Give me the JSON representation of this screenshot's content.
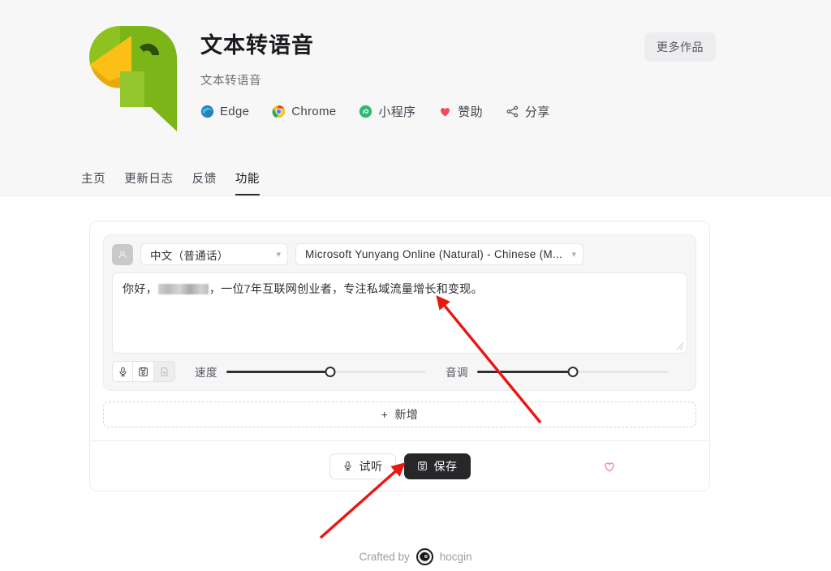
{
  "header": {
    "app_title": "文本转语音",
    "app_subtitle": "文本转语音",
    "more_works_label": "更多作品",
    "links": [
      {
        "label": "Edge",
        "icon": "edge-icon"
      },
      {
        "label": "Chrome",
        "icon": "chrome-icon"
      },
      {
        "label": "小程序",
        "icon": "miniprogram-icon"
      },
      {
        "label": "赞助",
        "icon": "heart-icon"
      },
      {
        "label": "分享",
        "icon": "share-icon"
      }
    ],
    "tabs": [
      {
        "label": "主页",
        "active": false
      },
      {
        "label": "更新日志",
        "active": false
      },
      {
        "label": "反馈",
        "active": false
      },
      {
        "label": "功能",
        "active": true
      }
    ]
  },
  "editor": {
    "language_select": {
      "value": "中文（普通话）"
    },
    "voice_select": {
      "value": "Microsoft Yunyang Online (Natural) - Chinese (M..."
    },
    "text_before": "你好，",
    "text_after": "，一位7年互联网创业者，专注私域流量增长和变现。",
    "toolbar_icons": [
      {
        "name": "microphone-icon",
        "disabled": false
      },
      {
        "name": "save-floppy-icon",
        "disabled": false
      },
      {
        "name": "add-file-icon",
        "disabled": true
      }
    ],
    "speed": {
      "label": "速度",
      "percent": 52
    },
    "pitch": {
      "label": "音调",
      "percent": 50
    },
    "add_label": "新增",
    "add_plus": "+"
  },
  "actions": {
    "preview_label": "试听",
    "save_label": "保存",
    "favorite_icon": "heart-outline-icon"
  },
  "footer": {
    "crafted_by": "Crafted by",
    "author": "hocgin"
  },
  "colors": {
    "page_bg": "#ffffff",
    "header_bg": "#f7f7f8",
    "panel_bg": "#f6f6f7",
    "dark_button": "#27272a",
    "accent_heart": "#ff5a6e",
    "favorite_pink": "#f472b6",
    "logo_green": "#7cb518",
    "logo_yellow": "#f9b917",
    "annotation_red": "#e8170f"
  }
}
